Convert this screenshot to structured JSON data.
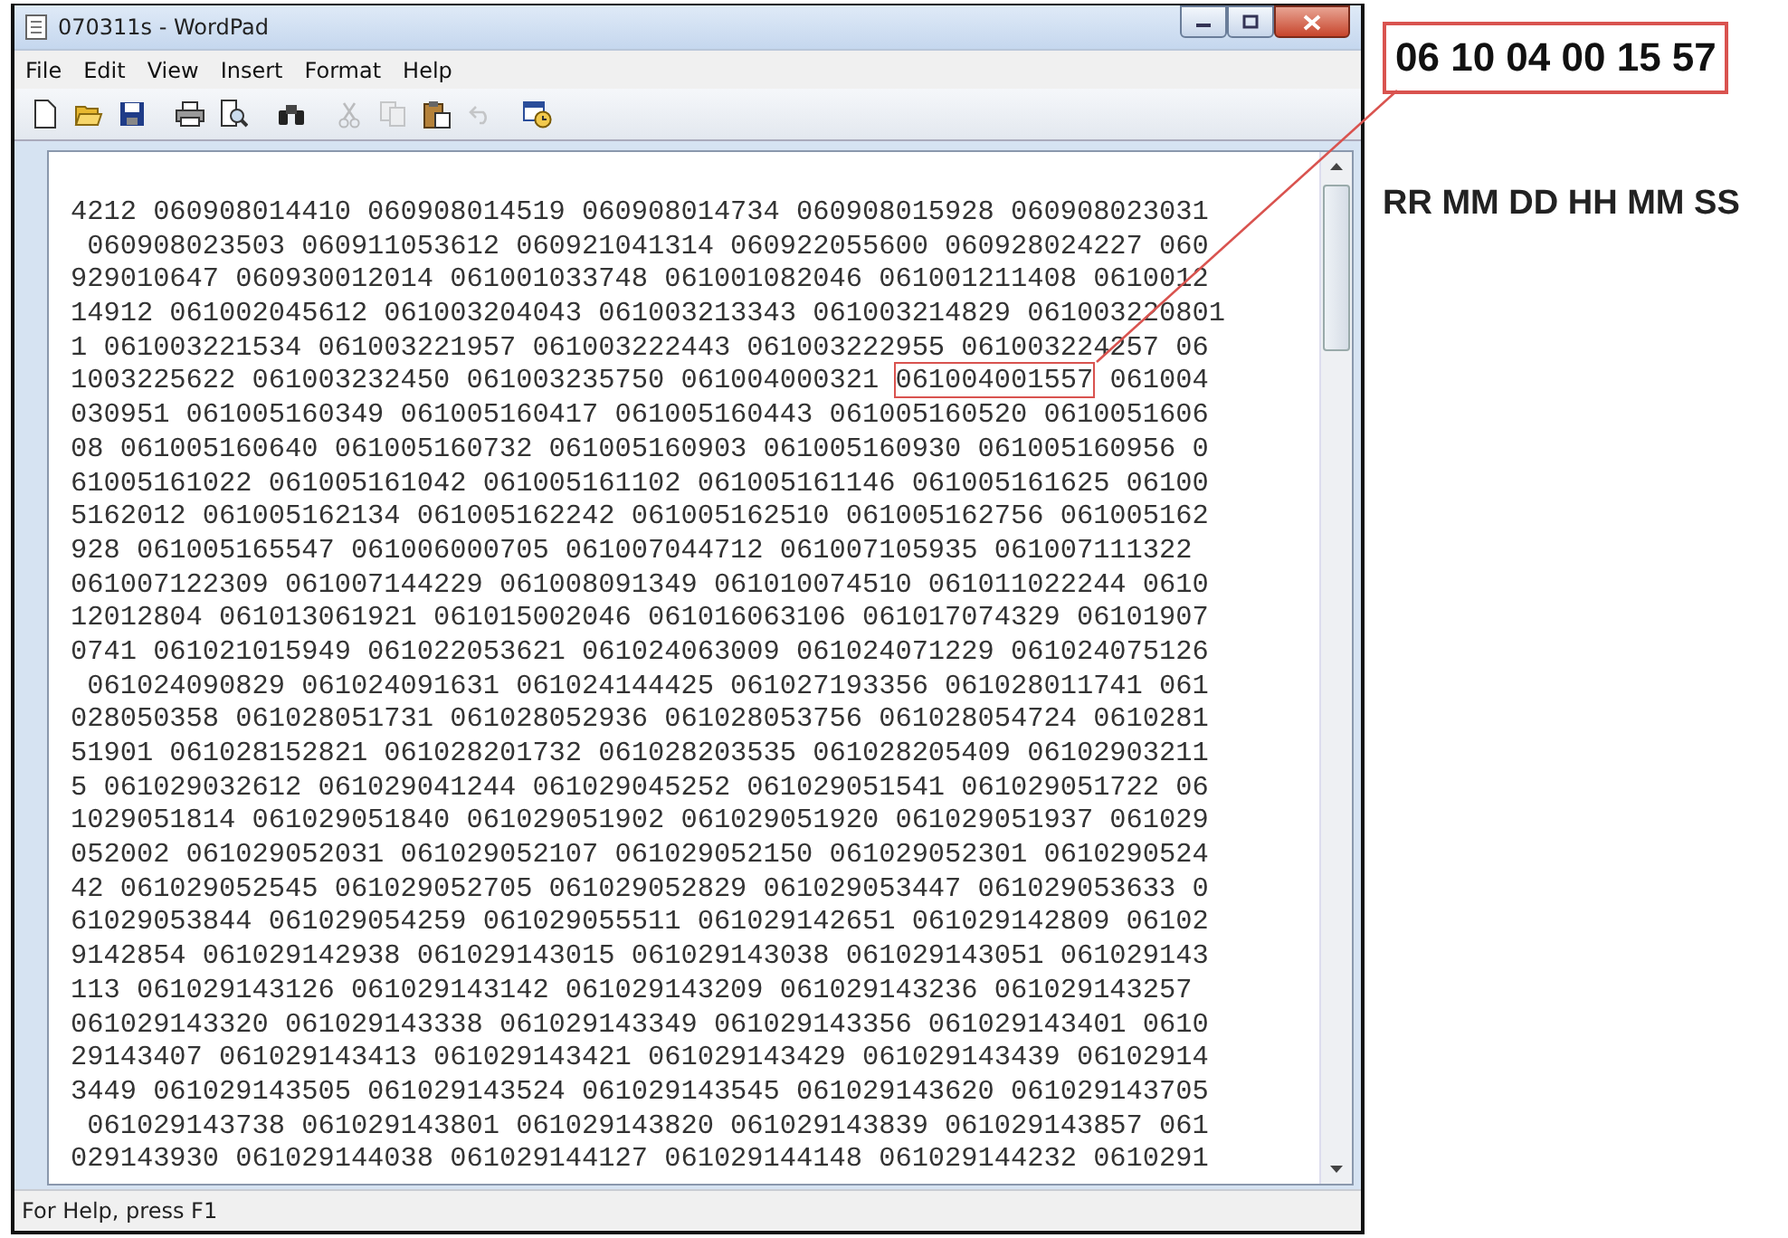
{
  "window": {
    "title": "070311s - WordPad"
  },
  "menu": [
    {
      "label": "File"
    },
    {
      "label": "Edit"
    },
    {
      "label": "View"
    },
    {
      "label": "Insert"
    },
    {
      "label": "Format"
    },
    {
      "label": "Help"
    }
  ],
  "toolbar": [
    {
      "kind": "new",
      "disabled": false
    },
    {
      "kind": "open",
      "disabled": false
    },
    {
      "kind": "save",
      "disabled": false
    },
    {
      "kind": "sep"
    },
    {
      "kind": "print",
      "disabled": false
    },
    {
      "kind": "preview",
      "disabled": false
    },
    {
      "kind": "sep"
    },
    {
      "kind": "find",
      "disabled": false
    },
    {
      "kind": "sep"
    },
    {
      "kind": "cut",
      "disabled": true
    },
    {
      "kind": "copy",
      "disabled": true
    },
    {
      "kind": "paste",
      "disabled": false
    },
    {
      "kind": "undo",
      "disabled": true
    },
    {
      "kind": "sep"
    },
    {
      "kind": "datetime",
      "disabled": false
    }
  ],
  "document": {
    "lines": [
      {
        "segments": [
          {
            "text": "4212 060908014410 060908014519 060908014734 060908015928 060908023031",
            "highlighted": false
          }
        ]
      },
      {
        "segments": [
          {
            "text": " 060908023503 060911053612 060921041314 060922055600 060928024227 060",
            "highlighted": false
          }
        ]
      },
      {
        "segments": [
          {
            "text": "929010647 060930012014 061001033748 061001082046 061001211408 0610012",
            "highlighted": false
          }
        ]
      },
      {
        "segments": [
          {
            "text": "14912 061002045612 061003204043 061003213343 061003214829 061003220801",
            "highlighted": false
          }
        ]
      },
      {
        "segments": [
          {
            "text": "1 061003221534 061003221957 061003222443 061003222955 061003224257 06",
            "highlighted": false
          }
        ]
      },
      {
        "segments": [
          {
            "text": "1003225622 061003232450 061003235750 061004000321 ",
            "highlighted": false
          },
          {
            "text": "061004001557",
            "highlighted": true
          },
          {
            "text": " 061004",
            "highlighted": false
          }
        ]
      },
      {
        "segments": [
          {
            "text": "030951 061005160349 061005160417 061005160443 061005160520 0610051606",
            "highlighted": false
          }
        ]
      },
      {
        "segments": [
          {
            "text": "08 061005160640 061005160732 061005160903 061005160930 061005160956 0",
            "highlighted": false
          }
        ]
      },
      {
        "segments": [
          {
            "text": "61005161022 061005161042 061005161102 061005161146 061005161625 06100",
            "highlighted": false
          }
        ]
      },
      {
        "segments": [
          {
            "text": "5162012 061005162134 061005162242 061005162510 061005162756 061005162",
            "highlighted": false
          }
        ]
      },
      {
        "segments": [
          {
            "text": "928 061005165547 061006000705 061007044712 061007105935 061007111322",
            "highlighted": false
          }
        ]
      },
      {
        "segments": [
          {
            "text": "061007122309 061007144229 061008091349 061010074510 061011022244 0610",
            "highlighted": false
          }
        ]
      },
      {
        "segments": [
          {
            "text": "12012804 061013061921 061015002046 061016063106 061017074329 06101907",
            "highlighted": false
          }
        ]
      },
      {
        "segments": [
          {
            "text": "0741 061021015949 061022053621 061024063009 061024071229 061024075126",
            "highlighted": false
          }
        ]
      },
      {
        "segments": [
          {
            "text": " 061024090829 061024091631 061024144425 061027193356 061028011741 061",
            "highlighted": false
          }
        ]
      },
      {
        "segments": [
          {
            "text": "028050358 061028051731 061028052936 061028053756 061028054724 0610281",
            "highlighted": false
          }
        ]
      },
      {
        "segments": [
          {
            "text": "51901 061028152821 061028201732 061028203535 061028205409 06102903211",
            "highlighted": false
          }
        ]
      },
      {
        "segments": [
          {
            "text": "5 061029032612 061029041244 061029045252 061029051541 061029051722 06",
            "highlighted": false
          }
        ]
      },
      {
        "segments": [
          {
            "text": "1029051814 061029051840 061029051902 061029051920 061029051937 061029",
            "highlighted": false
          }
        ]
      },
      {
        "segments": [
          {
            "text": "052002 061029052031 061029052107 061029052150 061029052301 0610290524",
            "highlighted": false
          }
        ]
      },
      {
        "segments": [
          {
            "text": "42 061029052545 061029052705 061029052829 061029053447 061029053633 0",
            "highlighted": false
          }
        ]
      },
      {
        "segments": [
          {
            "text": "61029053844 061029054259 061029055511 061029142651 061029142809 06102",
            "highlighted": false
          }
        ]
      },
      {
        "segments": [
          {
            "text": "9142854 061029142938 061029143015 061029143038 061029143051 061029143",
            "highlighted": false
          }
        ]
      },
      {
        "segments": [
          {
            "text": "113 061029143126 061029143142 061029143209 061029143236 061029143257",
            "highlighted": false
          }
        ]
      },
      {
        "segments": [
          {
            "text": "061029143320 061029143338 061029143349 061029143356 061029143401 0610",
            "highlighted": false
          }
        ]
      },
      {
        "segments": [
          {
            "text": "29143407 061029143413 061029143421 061029143429 061029143439 06102914",
            "highlighted": false
          }
        ]
      },
      {
        "segments": [
          {
            "text": "3449 061029143505 061029143524 061029143545 061029143620 061029143705",
            "highlighted": false
          }
        ]
      },
      {
        "segments": [
          {
            "text": " 061029143738 061029143801 061029143820 061029143839 061029143857 061",
            "highlighted": false
          }
        ]
      },
      {
        "segments": [
          {
            "text": "029143930 061029144038 061029144127 061029144148 061029144232 0610291",
            "highlighted": false
          }
        ]
      }
    ]
  },
  "status_bar": {
    "text": "For Help, press F1"
  },
  "annotation": {
    "callout": "06 10 04 00 15 57",
    "legend": "RR MM DD HH MM SS"
  }
}
